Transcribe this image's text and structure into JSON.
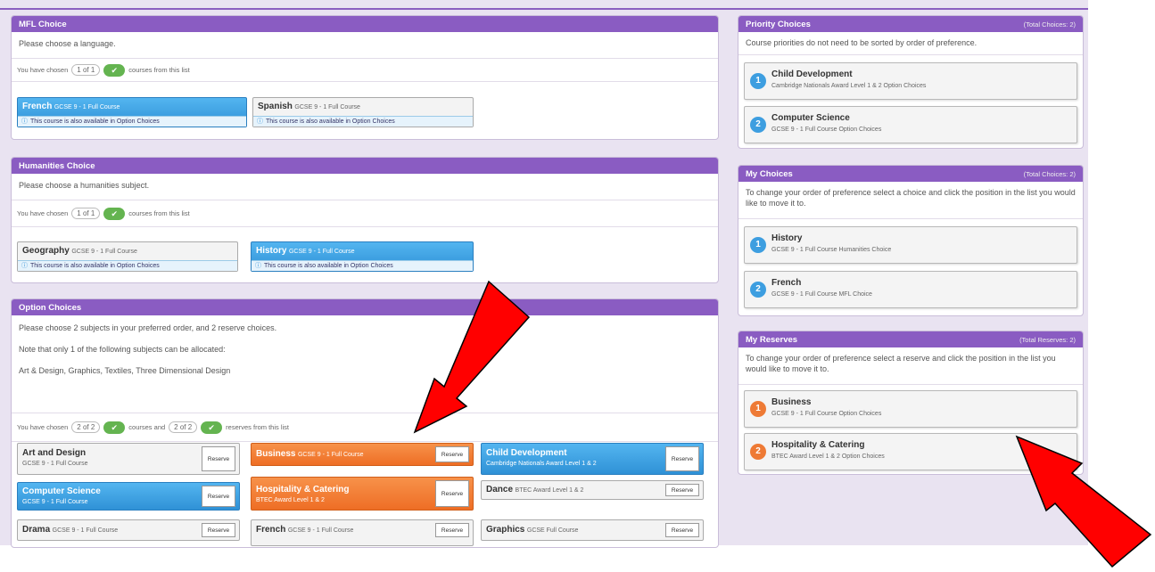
{
  "colors": {
    "header": "#8a5cc2",
    "selected_blue": "#2f91d6",
    "reserve_orange": "#ee6e25",
    "check_green": "#64b450",
    "arrow_red": "#ff0000"
  },
  "mfl": {
    "title": "MFL Choice",
    "instruction": "Please choose a language.",
    "chosen_prefix": "You have chosen",
    "chosen_count": "1 of 1",
    "chosen_suffix": "courses from this list",
    "courses": [
      {
        "name": "French",
        "sub": "GCSE 9 - 1 Full Course",
        "avail": "This course is also available in Option Choices",
        "state": "selected"
      },
      {
        "name": "Spanish",
        "sub": "GCSE 9 - 1 Full Course",
        "avail": "This course is also available in Option Choices",
        "state": "default"
      }
    ]
  },
  "humanities": {
    "title": "Humanities Choice",
    "instruction": "Please choose a humanities subject.",
    "chosen_prefix": "You have chosen",
    "chosen_count": "1 of 1",
    "chosen_suffix": "courses from this list",
    "courses": [
      {
        "name": "Geography",
        "sub": "GCSE 9 - 1 Full Course",
        "avail": "This course is also available in Option Choices",
        "state": "default"
      },
      {
        "name": "History",
        "sub": "GCSE 9 - 1 Full Course",
        "avail": "This course is also available in Option Choices",
        "state": "selected"
      }
    ]
  },
  "options": {
    "title": "Option Choices",
    "line1": "Please choose 2 subjects in your preferred order, and 2 reserve choices.",
    "line2": "Note that only 1 of the following subjects can be allocated:",
    "line3": "Art & Design, Graphics, Textiles, Three Dimensional Design",
    "chosen_prefix": "You have chosen",
    "chosen_count": "2 of 2",
    "chosen_mid": "courses and",
    "reserve_count": "2 of 2",
    "chosen_suffix": "reserves from this list",
    "reserve_label": "Reserve",
    "courses": [
      {
        "name": "Art and Design",
        "sub": "GCSE 9 - 1 Full Course",
        "state": "default"
      },
      {
        "name": "Business",
        "sub": "GCSE 9 - 1 Full Course",
        "state": "reserve"
      },
      {
        "name": "Child Development",
        "sub": "Cambridge Nationals Award Level 1 & 2",
        "state": "selected"
      },
      {
        "name": "Computer Science",
        "sub": "GCSE 9 - 1 Full Course",
        "state": "selected"
      },
      {
        "name": "Hospitality & Catering",
        "sub": "BTEC Award Level 1 & 2",
        "state": "reserve"
      },
      {
        "name": "Dance",
        "sub": "BTEC Award Level 1 & 2",
        "state": "default"
      },
      {
        "name": "Drama",
        "sub": "GCSE 9 - 1 Full Course",
        "state": "default"
      },
      {
        "name": "French",
        "sub": "GCSE 9 - 1 Full Course",
        "state": "default"
      },
      {
        "name": "Graphics",
        "sub": "GCSE Full Course",
        "state": "default"
      }
    ]
  },
  "priority": {
    "title": "Priority Choices",
    "total": "(Total Choices: 2)",
    "note": "Course priorities do not need to be sorted by order of preference.",
    "items": [
      {
        "num": "1",
        "name": "Child Development",
        "sub": "Cambridge Nationals Award Level 1 & 2 Option Choices"
      },
      {
        "num": "2",
        "name": "Computer Science",
        "sub": "GCSE 9 - 1 Full Course Option Choices"
      }
    ]
  },
  "my_choices": {
    "title": "My Choices",
    "total": "(Total Choices: 2)",
    "note": "To change your order of preference select a choice and click the position in the list you would like to move it to.",
    "items": [
      {
        "num": "1",
        "name": "History",
        "sub": "GCSE 9 - 1 Full Course Humanities Choice"
      },
      {
        "num": "2",
        "name": "French",
        "sub": "GCSE 9 - 1 Full Course MFL Choice"
      }
    ]
  },
  "my_reserves": {
    "title": "My Reserves",
    "total": "(Total Reserves: 2)",
    "note": "To change your order of preference select a reserve and click the position in the list you would like to move it to.",
    "items": [
      {
        "num": "1",
        "name": "Business",
        "sub": "GCSE 9 - 1 Full Course Option Choices"
      },
      {
        "num": "2",
        "name": "Hospitality & Catering",
        "sub": "BTEC Award Level 1 & 2 Option Choices"
      }
    ]
  }
}
